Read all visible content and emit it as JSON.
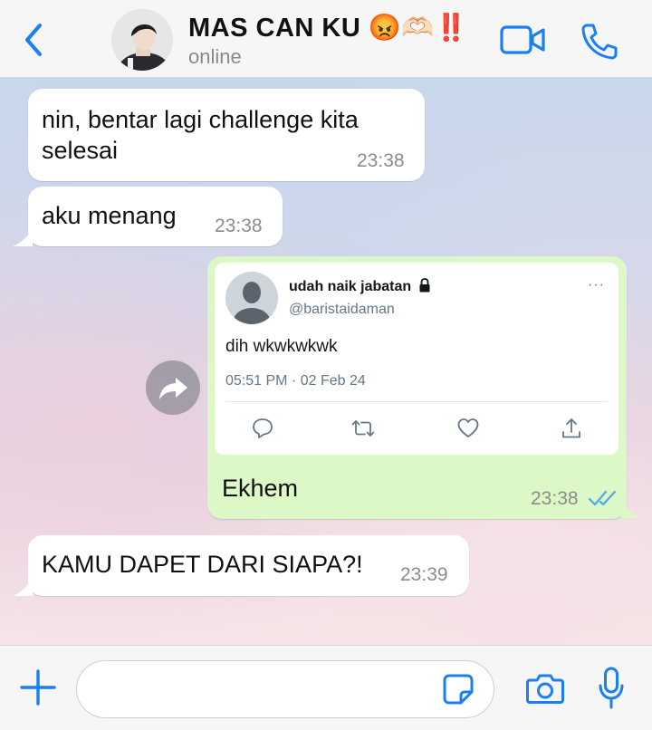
{
  "header": {
    "contact_name": "MAS CAN KU 😡🫶🏻‼️",
    "status": "online",
    "accent_color": "#1a7ff0"
  },
  "messages": [
    {
      "direction": "incoming",
      "text_line1": "nin, bentar lagi challenge kita",
      "text_line2": "selesai",
      "time": "23:38"
    },
    {
      "direction": "incoming",
      "text": "aku menang",
      "time": "23:38"
    },
    {
      "direction": "outgoing",
      "text": "Ekhem",
      "time": "23:38",
      "status": "read"
    },
    {
      "direction": "incoming",
      "text": "KAMU DAPET DARI SIAPA?!",
      "time": "23:39"
    }
  ],
  "tweet": {
    "name": "udah naik jabatan",
    "handle": "@baristaidaman",
    "text": "dih wkwkwkwk",
    "date": "05:51 PM · 02 Feb 24",
    "more": "···"
  },
  "input": {
    "placeholder": ""
  },
  "colors": {
    "incoming_bubble": "#ffffff",
    "outgoing_bubble": "#dcf8c6",
    "read_check": "#4fa8e8"
  }
}
